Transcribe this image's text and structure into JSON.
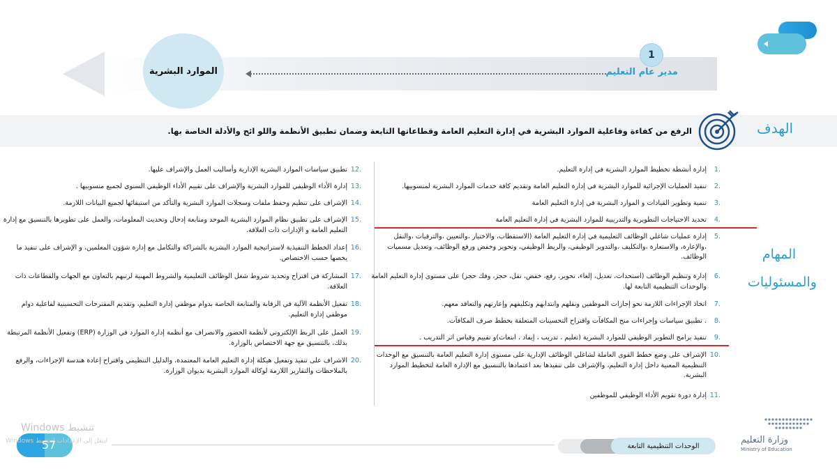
{
  "header": {
    "step_number": "1",
    "director_title": "مدير عام التعليم",
    "hr_title": "الموارد البشرية"
  },
  "goal": {
    "label": "الهدف",
    "text": "الرفع من كفاءة وفاعلية الموارد البشرية في إدارة التعليم العامة وقطاعاتها التابعة وضمان تطبيق الأنظمة واللو ائح والأدلة الخاصة بها."
  },
  "responsibilities": {
    "label": "المهام والمسئوليات",
    "right_column": [
      {
        "no": "1.",
        "text": "إدارة أنشطة تخطيط الموارد البشرية في إدارة التعليم."
      },
      {
        "no": "2.",
        "text": "تنفيذ العمليات الإجرائية للموارد البشرية في إدارة التعليم العامة وتقديم كافة خدمات الموارد البشرية لمنسوبيها."
      },
      {
        "no": "3.",
        "text": "تنمية وتطوير القيادات و الموارد البشرية في إدارة التعليم العامة"
      },
      {
        "no": "4.",
        "text": "تحديد الاحتياجات التطويرية والتدريبية للموارد البشرية في إدارة التعليم العامة"
      },
      {
        "no": "5.",
        "text": "إدارة عمليات شاغلي الوظائف التعليمية في إدارة التعليم العامة (الاستقطاب، والاختيار ،والتعيين ،والترقيات ،والنقل ،والإعارة، والاستعارة ،والتكليف ،والتدوير الوظيفي، والربط الوظيفي، وتحوير وخفض ورفع الوظائف، وتعديل مسميات الوظائف."
      },
      {
        "no": "6.",
        "text": "إدارة وتنظيم الوظائف (استحداث، تعديل، إلغاء، تحوير، رفع، خفض، نقل، حجز، وفك حجز) على مستوى إدارة التعليم العامة والوحدات التنظيمية التابعة لها."
      },
      {
        "no": "7.",
        "text": "اتخاذ الإجراءات اللازمة نحو إجازات الموظفين ونقلهم وانتدابهم وتكليفهم وإعارتهم والتعاقد معهم."
      },
      {
        "no": "8.",
        "text": ". تطبيق سياسات وإجراءات منح المكافآت واقتراح التحسينات المتعلقة بخطط صرف المكافآت."
      },
      {
        "no": "9.",
        "text": "تنفيذ برامج التطوير الوظيفي للموارد البشرية (تعليم ، تدريب ، إيفاد ، ابتعاث)و تقييم وقياس اثر التدريب ."
      },
      {
        "no": "10.",
        "text": "الإشراف على وضع خطط القوى العاملة لشاغلي الوظائف الإدارية على مستوى إدارة التعليم العامة بالتنسيق مع الوحدات التنظيمية المعنية داخل إدارة التعليم، والإشراف على تنفيذها بعد اعتمادها بالتنسيق مع الإدارة العامة لتخطيط الموارد البشرية."
      },
      {
        "no": "11.",
        "text": "إدارة دورة تقويم الأداء الوظيفي للموظفين"
      }
    ],
    "left_column": [
      {
        "no": "12.",
        "text": "تطبيق سياسات الموارد البشرية الإدارية وأساليب العمل والإشراف عليها."
      },
      {
        "no": "13.",
        "text": "إدارة الأداء الوظيفي للموارد البشرية والإشراف على تقييم الأداء الوظيفي السنوي لجميع منسوبيها ."
      },
      {
        "no": "14.",
        "text": "الإشراف على تنظيم وحفظ ملفات وسجلات الموارد البشرية والتأكد من استيفائها لجميع البيانات اللازمة."
      },
      {
        "no": "15.",
        "text": "الإشراف على تطبيق نظام الموارد البشرية الموحد ومتابعة إدخال وتحديث المعلومات، والعمل على تطويرها بالتنسيق مع إدارة التعليم العامة و الإدارات ذات العلاقة."
      },
      {
        "no": "16.",
        "text": "إعداد الخطط التنفيذية لاستراتيجية الموارد البشرية بالشراكة والتكامل مع إدارة شؤون المعلمين، و الإشراف على تنفيذ ما يخصها حسب الاختصاص."
      },
      {
        "no": "17.",
        "text": "المشاركة في اقتراح وتحديد شروط شغل الوظائف التعليمية والشروط المهنية لرتبهم بالتعاون مع الجهات والقطاعات ذات العلاقة."
      },
      {
        "no": "18.",
        "text": "تفعيل الأنظمة الآلية في الرقابة والمتابعة الخاصة بدوام موظفي إدارة التعليم، وتقديم المقترحات التحسينية لفاعلية دوام موظفي إدارة التعليم."
      },
      {
        "no": "19.",
        "text": "العمل على الربط الإلكتروني لأنظمة الحضور والانصراف مع أنظمة إدارة الموارد في الوزارة (ERP) وتفعيل الأنظمة المرتبطة بذلك، بالتنسيق مع جهة الاختصاص بالوزارة."
      },
      {
        "no": "20.",
        "text": "الاشراف على تنفيذ وتفعيل هيكلة إدارة التعليم العامة المعتمدة، والدليل التنظيمي واقتراح إعادة هندسة الإجراءات، والرفع بالملاحظات والتقارير اللازمة لوكالة الموارد البشرية بديوان الوزارة."
      }
    ]
  },
  "footer": {
    "section_label": "الوحدات التنظيمية التابعة",
    "page_number": "57",
    "windows_activate": "Windows تنشيط",
    "windows_sub": "انتقل إلى الإعدادات لتنشيط Windows",
    "ministry_ar": "وزارة التعليم",
    "ministry_en": "Ministry of Education"
  },
  "colors": {
    "accent_blue": "#2a9fd0",
    "light_blue": "#cfe8f2",
    "red_marker": "#d8282e"
  }
}
